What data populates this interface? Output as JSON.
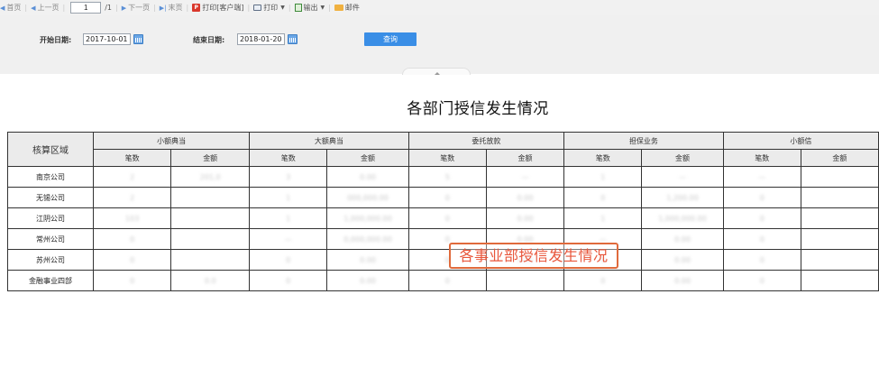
{
  "toolbar": {
    "first": "首页",
    "prev": "上一页",
    "page_value": "1",
    "page_total": "/1",
    "next": "下一页",
    "last": "末页",
    "print_client": "打印[客户端]",
    "print": "打印",
    "export": "输出",
    "mail": "邮件"
  },
  "filter": {
    "start_label": "开始日期:",
    "start_value": "2017-10-01",
    "end_label": "结束日期:",
    "end_value": "2018-01-20",
    "query": "查询"
  },
  "report": {
    "title": "各部门授信发生情况",
    "region_header": "核算区域",
    "groups": [
      "小额典当",
      "大额典当",
      "委托放款",
      "担保业务",
      "小额信"
    ],
    "sub_count": "笔数",
    "sub_amount": "金额",
    "rows": [
      {
        "name": "南京公司",
        "cells": [
          "2",
          "201,0",
          "3",
          "0.00",
          "5",
          "—",
          "1",
          "—",
          "—"
        ]
      },
      {
        "name": "无锡公司",
        "cells": [
          "2",
          "",
          "1",
          "000,000.00",
          "0",
          "0.00",
          "0",
          "1,200.00",
          "0"
        ]
      },
      {
        "name": "江阴公司",
        "cells": [
          "103",
          "",
          "1",
          "1,000,000.00",
          "0",
          "0.00",
          "1",
          "1,000,000.00",
          "0"
        ]
      },
      {
        "name": "常州公司",
        "cells": [
          "0",
          "",
          "—",
          "0,000,000.00",
          "0",
          "0.00",
          "—",
          "0.00",
          "0"
        ]
      },
      {
        "name": "苏州公司",
        "cells": [
          "0",
          "",
          "0",
          "0.00",
          "0",
          "0.00",
          "0",
          "0.00",
          "0"
        ]
      },
      {
        "name": "金融事业四部",
        "cells": [
          "0",
          "0.0",
          "0",
          "0.00",
          "0",
          "",
          "0",
          "0.00",
          "0"
        ]
      }
    ]
  },
  "overlay_text": "各事业部授信发生情况",
  "colors": {
    "accent": "#3a8ee6",
    "overlay": "#e8553a",
    "header_bg": "#ebebeb"
  }
}
